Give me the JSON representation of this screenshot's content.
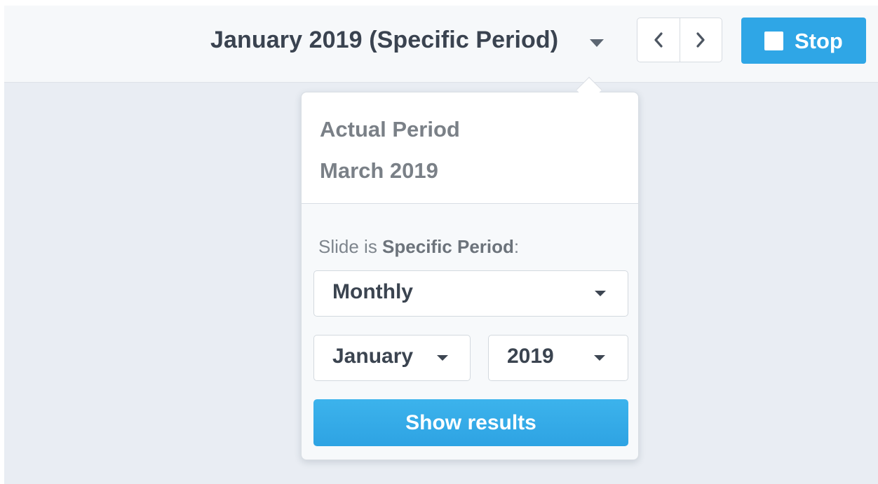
{
  "header": {
    "period_title": "January 2019 (Specific Period)",
    "prev_icon": "chevron-left-icon",
    "next_icon": "chevron-right-icon",
    "stop_label": "Stop",
    "stop_icon": "square-icon"
  },
  "popover": {
    "actual_label": "Actual Period",
    "actual_value": "March 2019",
    "slide_is_prefix": "Slide is ",
    "slide_is_mode": "Specific Period",
    "slide_is_suffix": ":",
    "frequency_select": {
      "value": "Monthly"
    },
    "month_select": {
      "value": "January"
    },
    "year_select": {
      "value": "2019"
    },
    "show_results_label": "Show results"
  },
  "colors": {
    "accent": "#2fa6e6",
    "background": "#e9edf3",
    "header_bg": "#f6f8fa",
    "text_dark": "#3a4350",
    "text_muted": "#7a8087"
  }
}
